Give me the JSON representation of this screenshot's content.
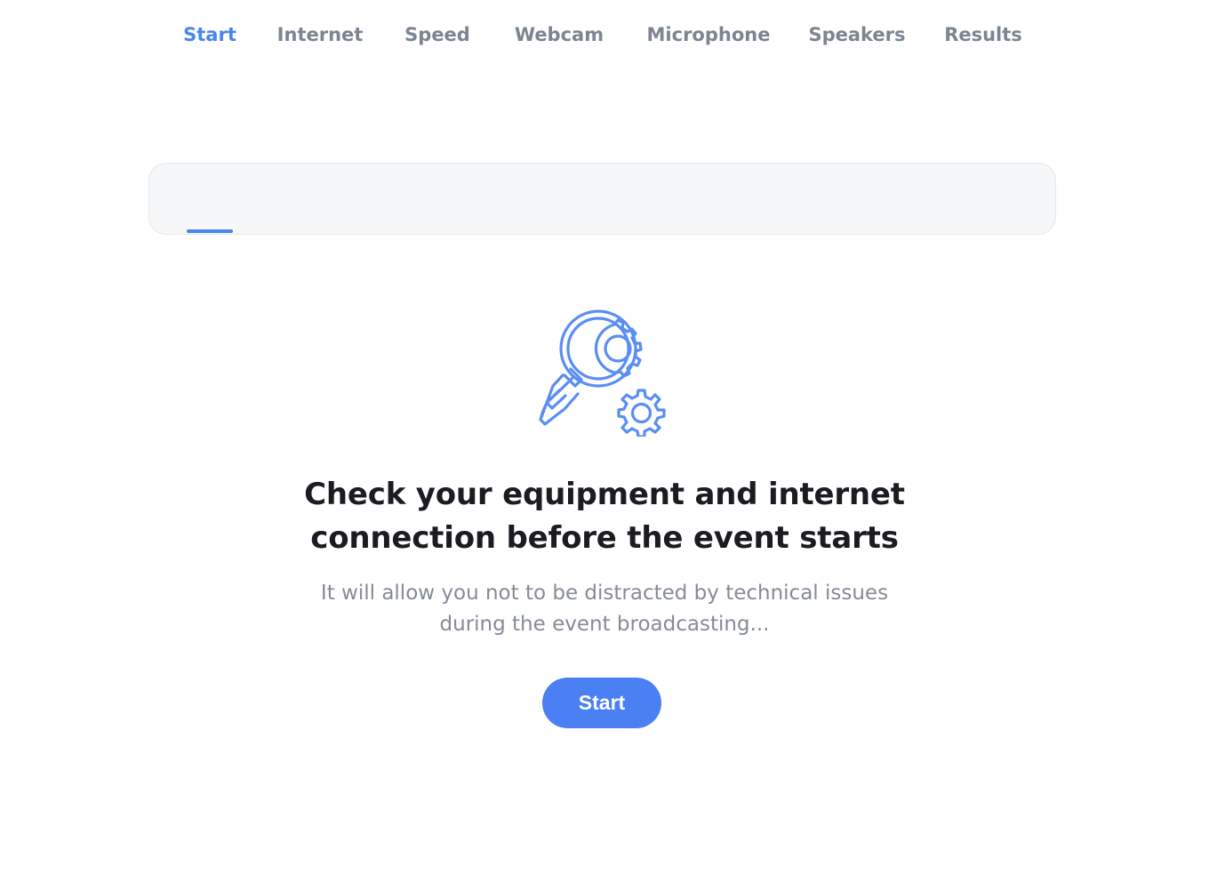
{
  "tabs": [
    {
      "label": "Start",
      "active": true
    },
    {
      "label": "Internet",
      "active": false
    },
    {
      "label": "Speed",
      "active": false
    },
    {
      "label": "Webcam",
      "active": false
    },
    {
      "label": "Microphone",
      "active": false
    },
    {
      "label": "Speakers",
      "active": false
    },
    {
      "label": "Results",
      "active": false
    }
  ],
  "hero": {
    "icon": "magnifier-gears-icon",
    "title_line1": "Check your equipment and internet",
    "title_line2": "connection before the event starts",
    "subtitle_line1": "It will allow you not to be distracted by technical issues",
    "subtitle_line2": "during the event broadcasting..."
  },
  "start_button": {
    "label": "Start"
  },
  "colors": {
    "accent": "#4a86f0",
    "button": "#4a80f3",
    "tab_inactive": "#7d8592",
    "heading": "#1a1c22",
    "body_text": "#858b97",
    "tabbar_bg": "#f6f7f8"
  }
}
